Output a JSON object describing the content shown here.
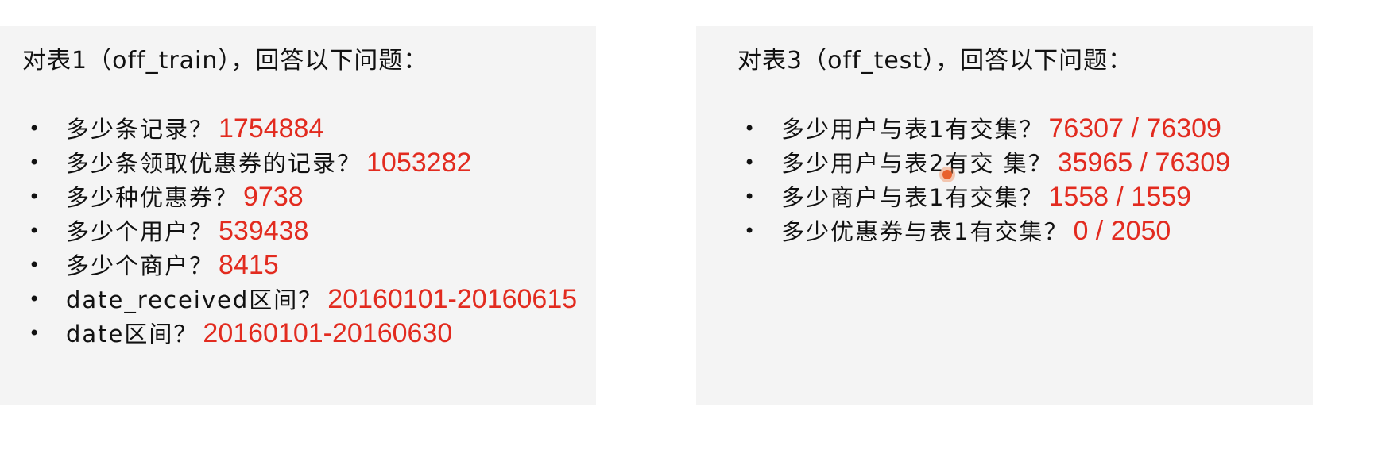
{
  "left_panel": {
    "title": "对表1（off_train），回答以下问题：",
    "questions": [
      {
        "text": "多少条记录？",
        "answer": "1754884"
      },
      {
        "text": "多少条领取优惠券的记录？",
        "answer": "1053282"
      },
      {
        "text": "多少种优惠券？",
        "answer": "9738"
      },
      {
        "text": "多少个用户？",
        "answer": "539438"
      },
      {
        "text": "多少个商户？",
        "answer": "8415"
      },
      {
        "text": "date_received区间？",
        "answer": "20160101-20160615"
      },
      {
        "text": "date区间？",
        "answer": "20160101-20160630"
      }
    ]
  },
  "right_panel": {
    "title": "对表3（off_test），回答以下问题：",
    "questions": [
      {
        "text": "多少用户与表1有交集？",
        "answer": "76307 / 76309"
      },
      {
        "text": "多少用户与表2有交 集？",
        "answer": "35965 / 76309"
      },
      {
        "text": "多少商户与表1有交集？",
        "answer": "1558 / 1559"
      },
      {
        "text": "多少优惠券与表1有交集？",
        "answer": "0 / 2050"
      }
    ]
  },
  "bullet_glyph": "•",
  "colors": {
    "answer": "#e22b1f",
    "panel_bg": "#f4f4f4",
    "cursor": "#e8602c"
  }
}
